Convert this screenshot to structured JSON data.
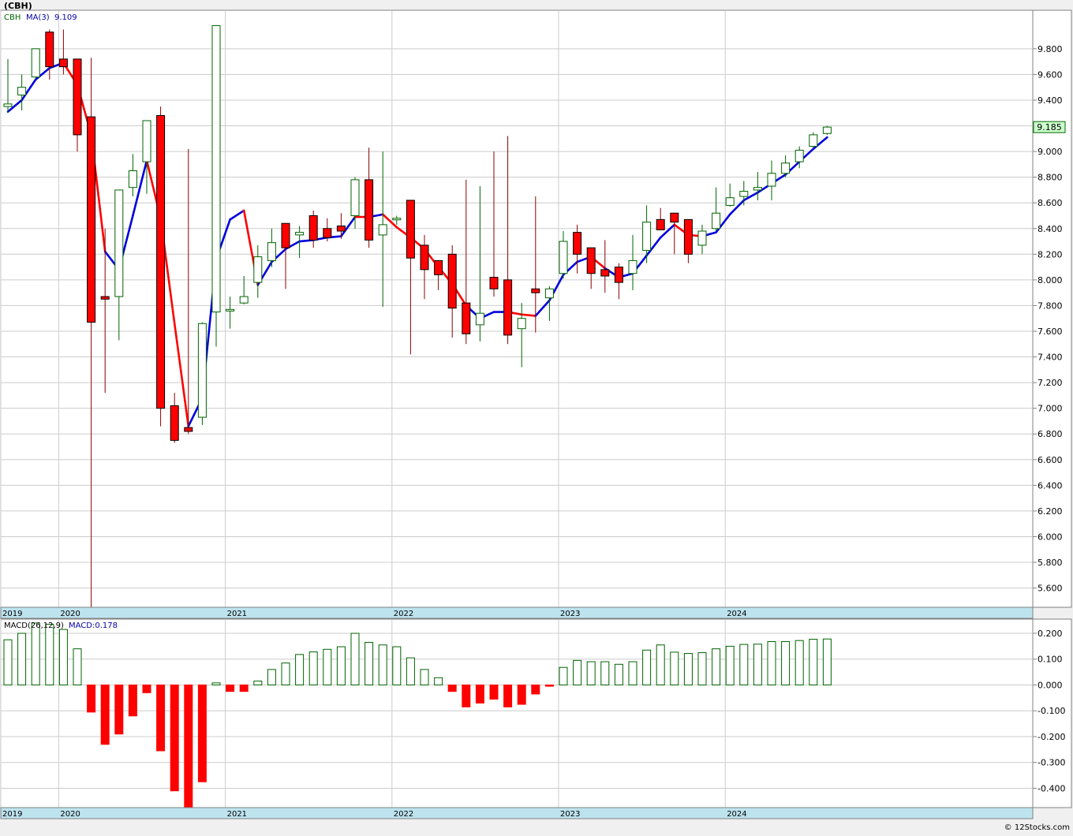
{
  "symbol_title": "(CBH)",
  "footer": "© 12Stocks.com",
  "colors": {
    "up_candle": "#006400",
    "down_candle": "#ff0000",
    "ma_up": "#0000dd",
    "ma_down": "#ff0000",
    "macd_pos": "#006400",
    "macd_neg": "#ff0000",
    "price_badge_bg": "#ccffcc",
    "date_band": "#bde3ef"
  },
  "chart_data": [
    {
      "type": "candlestick",
      "title": "(CBH)",
      "symbol": "CBH",
      "ma_label": "MA(3)",
      "ma_value": "9.109",
      "last_price_label": "9.185",
      "ylim": [
        5.45,
        10.1
      ],
      "y_ticks": [
        "9.800",
        "9.600",
        "9.400",
        "9.200",
        "9.000",
        "8.800",
        "8.600",
        "8.400",
        "8.200",
        "8.000",
        "7.800",
        "7.600",
        "7.400",
        "7.200",
        "7.000",
        "6.800",
        "6.600",
        "6.400",
        "6.200",
        "6.000",
        "5.800",
        "5.600"
      ],
      "year_labels": [
        "2019",
        "2020",
        "2021",
        "2022",
        "2023",
        "2024"
      ],
      "grid": true,
      "candles": [
        {
          "o": 9.35,
          "h": 9.72,
          "l": 9.3,
          "c": 9.37
        },
        {
          "o": 9.44,
          "h": 9.6,
          "l": 9.32,
          "c": 9.5
        },
        {
          "o": 9.58,
          "h": 9.8,
          "l": 9.56,
          "c": 9.8
        },
        {
          "o": 9.93,
          "h": 9.95,
          "l": 9.56,
          "c": 9.66
        },
        {
          "o": 9.72,
          "h": 9.95,
          "l": 9.6,
          "c": 9.66
        },
        {
          "o": 9.72,
          "h": 9.72,
          "l": 9.0,
          "c": 9.13
        },
        {
          "o": 9.27,
          "h": 9.73,
          "l": 5.45,
          "c": 7.67
        },
        {
          "o": 7.87,
          "h": 8.4,
          "l": 7.12,
          "c": 7.85
        },
        {
          "o": 7.87,
          "h": 8.18,
          "l": 7.53,
          "c": 8.7
        },
        {
          "o": 8.72,
          "h": 8.98,
          "l": 8.65,
          "c": 8.85
        },
        {
          "o": 8.92,
          "h": 9.24,
          "l": 8.67,
          "c": 9.24
        },
        {
          "o": 9.28,
          "h": 9.35,
          "l": 6.86,
          "c": 7.0
        },
        {
          "o": 7.02,
          "h": 7.12,
          "l": 6.73,
          "c": 6.75
        },
        {
          "o": 6.85,
          "h": 9.02,
          "l": 6.8,
          "c": 6.82
        },
        {
          "o": 6.93,
          "h": 7.67,
          "l": 6.87,
          "c": 7.66
        },
        {
          "o": 7.75,
          "h": 9.98,
          "l": 7.48,
          "c": 9.98
        },
        {
          "o": 7.77,
          "h": 7.87,
          "l": 7.62,
          "c": 7.77
        },
        {
          "o": 7.82,
          "h": 8.03,
          "l": 7.81,
          "c": 7.87
        },
        {
          "o": 7.98,
          "h": 8.27,
          "l": 7.86,
          "c": 8.18
        },
        {
          "o": 8.15,
          "h": 8.4,
          "l": 8.1,
          "c": 8.29
        },
        {
          "o": 8.44,
          "h": 8.44,
          "l": 7.93,
          "c": 8.25
        },
        {
          "o": 8.35,
          "h": 8.42,
          "l": 8.17,
          "c": 8.37
        },
        {
          "o": 8.5,
          "h": 8.54,
          "l": 8.25,
          "c": 8.31
        },
        {
          "o": 8.4,
          "h": 8.48,
          "l": 8.3,
          "c": 8.33
        },
        {
          "o": 8.42,
          "h": 8.52,
          "l": 8.32,
          "c": 8.38
        },
        {
          "o": 8.5,
          "h": 8.8,
          "l": 8.4,
          "c": 8.78
        },
        {
          "o": 8.78,
          "h": 9.03,
          "l": 8.25,
          "c": 8.31
        },
        {
          "o": 8.35,
          "h": 9.0,
          "l": 7.79,
          "c": 8.43
        },
        {
          "o": 8.48,
          "h": 8.5,
          "l": 8.43,
          "c": 8.48
        },
        {
          "o": 8.62,
          "h": 8.62,
          "l": 7.42,
          "c": 8.17
        },
        {
          "o": 8.27,
          "h": 8.35,
          "l": 7.85,
          "c": 8.08
        },
        {
          "o": 8.15,
          "h": 8.15,
          "l": 7.92,
          "c": 8.04
        },
        {
          "o": 8.2,
          "h": 8.27,
          "l": 7.55,
          "c": 7.78
        },
        {
          "o": 7.82,
          "h": 8.78,
          "l": 7.5,
          "c": 7.58
        },
        {
          "o": 7.65,
          "h": 8.73,
          "l": 7.52,
          "c": 7.74
        },
        {
          "o": 8.02,
          "h": 9.0,
          "l": 7.87,
          "c": 7.93
        },
        {
          "o": 8.0,
          "h": 9.12,
          "l": 7.5,
          "c": 7.57
        },
        {
          "o": 7.62,
          "h": 7.82,
          "l": 7.32,
          "c": 7.7
        },
        {
          "o": 7.93,
          "h": 8.65,
          "l": 7.59,
          "c": 7.9
        },
        {
          "o": 7.86,
          "h": 7.95,
          "l": 7.68,
          "c": 7.93
        },
        {
          "o": 8.05,
          "h": 8.38,
          "l": 8.01,
          "c": 8.3
        },
        {
          "o": 8.37,
          "h": 8.43,
          "l": 8.05,
          "c": 8.2
        },
        {
          "o": 8.25,
          "h": 8.25,
          "l": 7.93,
          "c": 8.05
        },
        {
          "o": 8.08,
          "h": 8.31,
          "l": 7.9,
          "c": 8.03
        },
        {
          "o": 8.1,
          "h": 8.13,
          "l": 7.85,
          "c": 7.98
        },
        {
          "o": 8.05,
          "h": 8.35,
          "l": 7.92,
          "c": 8.15
        },
        {
          "o": 8.23,
          "h": 8.58,
          "l": 8.13,
          "c": 8.45
        },
        {
          "o": 8.47,
          "h": 8.56,
          "l": 8.4,
          "c": 8.39
        },
        {
          "o": 8.52,
          "h": 8.52,
          "l": 8.2,
          "c": 8.45
        },
        {
          "o": 8.47,
          "h": 8.47,
          "l": 8.13,
          "c": 8.2
        },
        {
          "o": 8.27,
          "h": 8.43,
          "l": 8.2,
          "c": 8.38
        },
        {
          "o": 8.4,
          "h": 8.72,
          "l": 8.38,
          "c": 8.52
        },
        {
          "o": 8.58,
          "h": 8.75,
          "l": 8.57,
          "c": 8.64
        },
        {
          "o": 8.65,
          "h": 8.77,
          "l": 8.58,
          "c": 8.69
        },
        {
          "o": 8.7,
          "h": 8.84,
          "l": 8.62,
          "c": 8.72
        },
        {
          "o": 8.73,
          "h": 8.93,
          "l": 8.62,
          "c": 8.83
        },
        {
          "o": 8.83,
          "h": 8.97,
          "l": 8.8,
          "c": 8.91
        },
        {
          "o": 8.92,
          "h": 9.04,
          "l": 8.87,
          "c": 9.01
        },
        {
          "o": 9.04,
          "h": 9.15,
          "l": 9.03,
          "c": 9.13
        },
        {
          "o": 9.14,
          "h": 9.2,
          "l": 9.13,
          "c": 9.19
        }
      ],
      "ma": [
        9.31,
        9.4,
        9.56,
        9.65,
        9.69,
        9.52,
        9.13,
        8.22,
        8.08,
        8.5,
        8.93,
        8.48,
        7.66,
        6.86,
        7.08,
        8.16,
        8.47,
        8.54,
        7.96,
        8.14,
        8.24,
        8.3,
        8.31,
        8.33,
        8.34,
        8.49,
        8.49,
        8.51,
        8.41,
        8.33,
        8.24,
        8.1,
        7.97,
        7.8,
        7.7,
        7.75,
        7.75,
        7.73,
        7.72,
        7.84,
        8.04,
        8.14,
        8.18,
        8.09,
        8.02,
        8.05,
        8.19,
        8.33,
        8.43,
        8.35,
        8.34,
        8.37,
        8.51,
        8.62,
        8.68,
        8.75,
        8.82,
        8.92,
        9.02,
        9.11
      ],
      "ma_color": [
        "u",
        "u",
        "u",
        "u",
        "u",
        "d",
        "d",
        "d",
        "u",
        "u",
        "u",
        "d",
        "d",
        "d",
        "u",
        "u",
        "u",
        "u",
        "d",
        "u",
        "u",
        "u",
        "u",
        "u",
        "u",
        "u",
        "d",
        "u",
        "d",
        "d",
        "d",
        "d",
        "d",
        "d",
        "u",
        "u",
        "u",
        "d",
        "d",
        "u",
        "u",
        "u",
        "u",
        "d",
        "u",
        "u",
        "u",
        "u",
        "u",
        "d",
        "d",
        "u",
        "u",
        "u",
        "u",
        "u",
        "u",
        "u",
        "u",
        "u"
      ]
    },
    {
      "type": "bar",
      "title": "MACD(26,12,9)",
      "value_label": "MACD:0.178",
      "ylim": [
        -0.475,
        0.255
      ],
      "y_ticks": [
        "0.200",
        "0.100",
        "0.000",
        "-0.100",
        "-0.200",
        "-0.300",
        "-0.400"
      ],
      "year_labels": [
        "2019",
        "2020",
        "2021",
        "2022",
        "2023",
        "2024"
      ],
      "values": [
        0.175,
        0.2,
        0.24,
        0.235,
        0.215,
        0.14,
        -0.105,
        -0.23,
        -0.19,
        -0.12,
        -0.03,
        -0.255,
        -0.41,
        -0.475,
        -0.375,
        0.008,
        -0.025,
        -0.025,
        0.015,
        0.06,
        0.085,
        0.118,
        0.128,
        0.138,
        0.148,
        0.2,
        0.165,
        0.155,
        0.148,
        0.105,
        0.06,
        0.028,
        -0.025,
        -0.085,
        -0.07,
        -0.055,
        -0.085,
        -0.075,
        -0.035,
        -0.005,
        0.068,
        0.095,
        0.09,
        0.09,
        0.08,
        0.09,
        0.135,
        0.155,
        0.127,
        0.122,
        0.125,
        0.14,
        0.15,
        0.157,
        0.158,
        0.168,
        0.168,
        0.172,
        0.177,
        0.178
      ]
    }
  ]
}
